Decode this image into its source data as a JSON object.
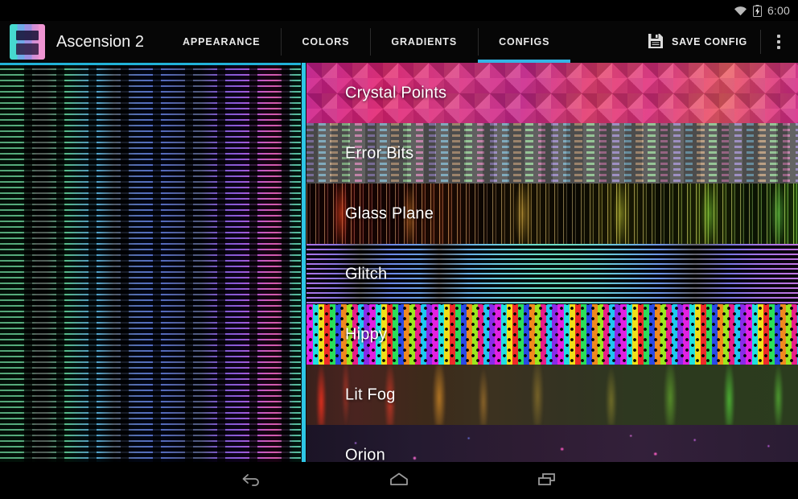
{
  "statusbar": {
    "time": "6:00",
    "icons": [
      "wifi-icon",
      "battery-charging-icon"
    ]
  },
  "actionbar": {
    "app_icon": "app-logo-icon",
    "title": "Ascension 2",
    "tabs": [
      {
        "label": "APPEARANCE",
        "active": false
      },
      {
        "label": "COLORS",
        "active": false
      },
      {
        "label": "GRADIENTS",
        "active": false
      },
      {
        "label": "CONFIGS",
        "active": true
      }
    ],
    "save_icon": "save-floppy-icon",
    "save_label": "SAVE CONFIG",
    "overflow_icon": "overflow-menu-icon",
    "accent_color": "#33b5e5"
  },
  "preview": {
    "name": "live-wallpaper-preview",
    "description": "Ascension 2 live wallpaper scanline preview"
  },
  "scrollbar": {
    "name": "config-list-scrollbar",
    "color": "#2ec6e6"
  },
  "configs": {
    "items": [
      {
        "label": "Crystal Points",
        "texture": "t-crystal"
      },
      {
        "label": "Error Bits",
        "texture": "t-error"
      },
      {
        "label": "Glass Plane",
        "texture": "t-glass"
      },
      {
        "label": "Glitch",
        "texture": "t-glitch"
      },
      {
        "label": "Hippy",
        "texture": "t-hippy"
      },
      {
        "label": "Lit Fog",
        "texture": "t-fog"
      },
      {
        "label": "Orion",
        "texture": "t-orion"
      }
    ]
  },
  "navbar": {
    "buttons": [
      {
        "name": "nav-back-button",
        "icon": "back-arrow-icon"
      },
      {
        "name": "nav-home-button",
        "icon": "home-icon"
      },
      {
        "name": "nav-recents-button",
        "icon": "recents-icon"
      }
    ]
  }
}
